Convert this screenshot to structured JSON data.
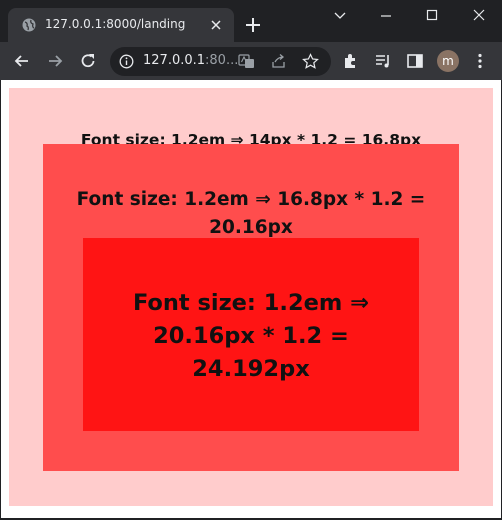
{
  "browser": {
    "tab_title": "127.0.0.1:8000/landing",
    "url_host": "127.0.0.1",
    "url_rest": ":80...",
    "profile_initial": "m"
  },
  "page": {
    "level1_text": "Font size: 1.2em ⇒ 14px * 1.2 = 16.8px",
    "level2_text": "Font size: 1.2em ⇒ 16.8px * 1.2 = 20.16px",
    "level3_text": "Font size: 1.2em ⇒ 20.16px * 1.2 = 24.192px",
    "colors": {
      "level1_bg": "#ffcccc",
      "level2_bg": "#ff4d4d",
      "level3_bg": "#ff1414"
    }
  },
  "icons": [
    "globe-icon",
    "close-icon",
    "plus-icon",
    "minimize-icon",
    "maximize-icon",
    "window-close-icon",
    "back-icon",
    "forward-icon",
    "reload-icon",
    "info-icon",
    "translate-icon",
    "share-icon",
    "star-icon",
    "extensions-icon",
    "media-icon",
    "sidebar-icon",
    "chevron-down-icon"
  ]
}
